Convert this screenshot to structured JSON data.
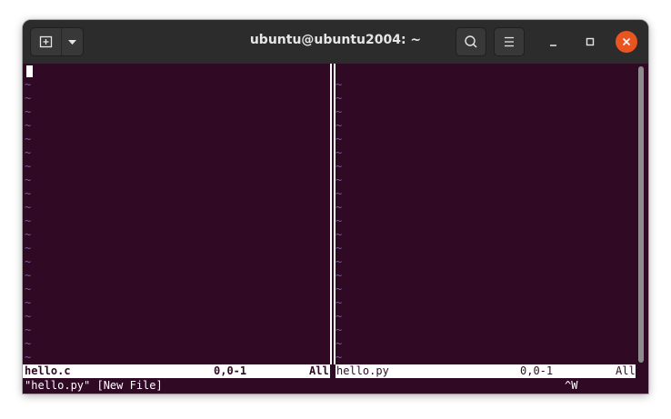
{
  "window": {
    "title": "ubuntu@ubuntu2004: ~"
  },
  "icons": {
    "new_tab": "new-tab-icon",
    "menu_dropdown": "chevron-down-icon",
    "search": "search-icon",
    "hamburger": "hamburger-menu-icon",
    "minimize": "minimize-icon",
    "maximize": "maximize-icon",
    "close": "close-icon"
  },
  "colors": {
    "terminal_bg": "#300a24",
    "titlebar_bg": "#2c2c2c",
    "close_button": "#e9541f",
    "tilde": "#6f5fa0"
  },
  "panes": {
    "left": {
      "status_filename": "hello.c",
      "status_position": "0,0-1",
      "status_scroll": "All"
    },
    "right": {
      "status_filename": "hello.py",
      "status_position": "0,0-1",
      "status_scroll": "All"
    }
  },
  "command_line": {
    "message": "\"hello.py\" [New File]",
    "pending_keys": "^W"
  },
  "tilde_char": "~"
}
